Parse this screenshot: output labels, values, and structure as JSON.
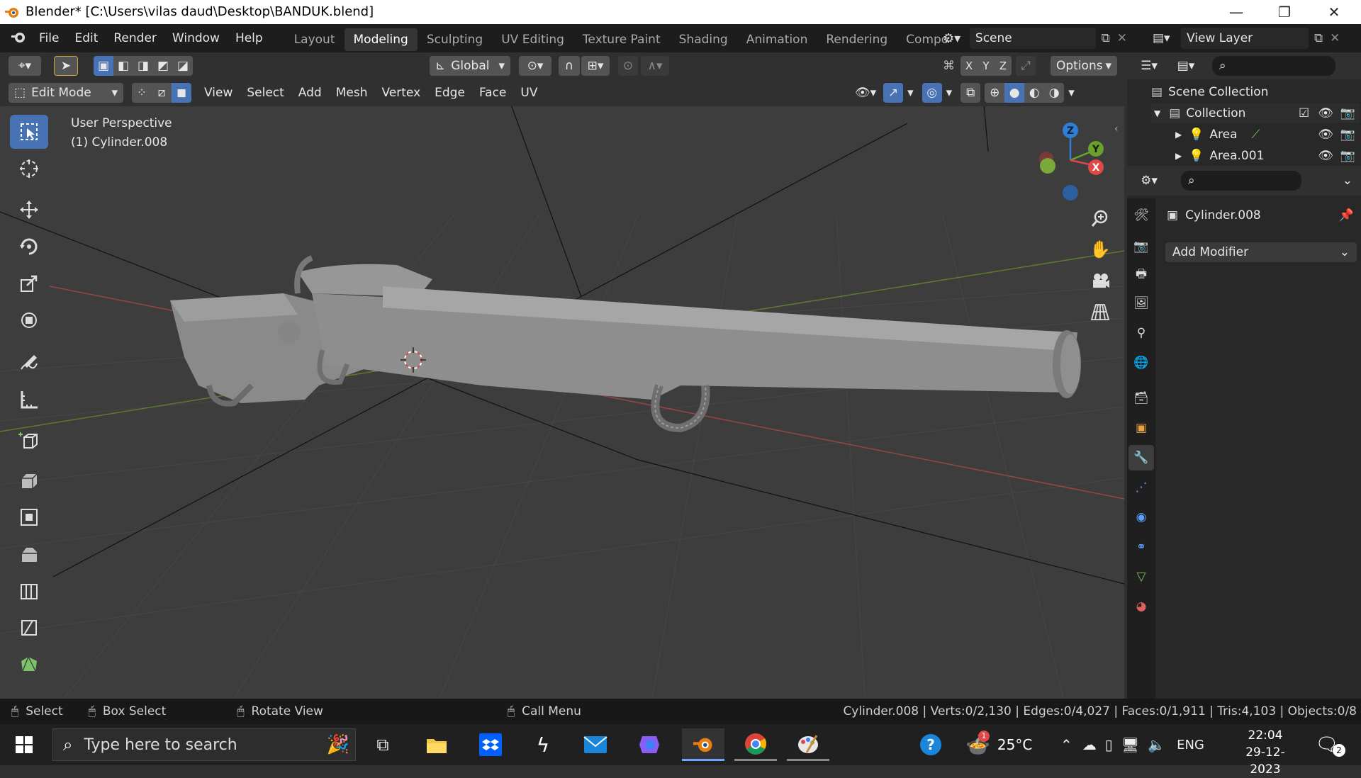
{
  "titlebar": {
    "title": "Blender* [C:\\Users\\vilas daud\\Desktop\\BANDUK.blend]",
    "minimize": "—",
    "restore": "❐",
    "close": "✕"
  },
  "menubar": {
    "items": [
      "File",
      "Edit",
      "Render",
      "Window",
      "Help"
    ]
  },
  "workspaces": [
    "Layout",
    "Modeling",
    "Sculpting",
    "UV Editing",
    "Texture Paint",
    "Shading",
    "Animation",
    "Rendering",
    "Compos"
  ],
  "active_workspace": "Modeling",
  "scene": {
    "name": "Scene"
  },
  "view_layer": {
    "name": "View Layer"
  },
  "tool_header": {
    "orientation": "Global",
    "axes": [
      "X",
      "Y",
      "Z"
    ],
    "options": "Options"
  },
  "viewport_header": {
    "mode": "Edit Mode",
    "menus": [
      "View",
      "Select",
      "Add",
      "Mesh",
      "Vertex",
      "Edge",
      "Face",
      "UV"
    ]
  },
  "viewport": {
    "perspective": "User Perspective",
    "object_label": "(1) Cylinder.008",
    "gizmo_axes": {
      "z": "Z",
      "y": "Y",
      "x": "X"
    }
  },
  "outliner": {
    "root": "Scene Collection",
    "collection": "Collection",
    "items": [
      "Area",
      "Area.001"
    ]
  },
  "properties": {
    "object": "Cylinder.008",
    "add_modifier": "Add Modifier"
  },
  "statusbar": {
    "select": "Select",
    "box_select": "Box Select",
    "rotate_view": "Rotate View",
    "call_menu": "Call Menu",
    "stats": "Cylinder.008 | Verts:0/2,130 | Edges:0/4,027 | Faces:0/1,911 | Tris:4,103 | Objects:0/8"
  },
  "taskbar": {
    "search_placeholder": "Type here to search",
    "weather": "25°C",
    "language": "ENG",
    "time": "22:04",
    "date": "29-12-2023",
    "notification_count": "2",
    "weather_badge": "1"
  },
  "colors": {
    "accent": "#4772b3",
    "header": "#303030",
    "viewport": "#3d3d3d",
    "panel": "#282828",
    "x_axis": "#e04848",
    "y_axis": "#6aa12b",
    "z_axis": "#2f7dd6"
  }
}
